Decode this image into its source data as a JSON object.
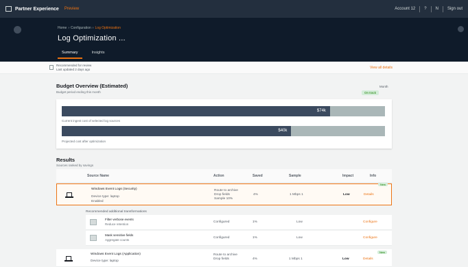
{
  "topnav": {
    "brand": "Partner Experience",
    "tag": "Preview",
    "right_text": "Account 12",
    "right_item_1": "?",
    "right_item_2": "N",
    "right_item_3": "Sign out"
  },
  "header": {
    "breadcrumbs": [
      "Home",
      "›",
      "Configuration",
      "›",
      "Log Optimization"
    ],
    "title": "Log Optimization ...",
    "tabs": [
      {
        "label": "Summary",
        "active": true
      },
      {
        "label": "Insights",
        "active": false
      }
    ]
  },
  "strip": {
    "line1": "Recommended for review",
    "line2": "Last updated 2 days ago",
    "link": "View all details"
  },
  "budget": {
    "title": "Budget Overview (Estimated)",
    "subtitle": "Budget period ending this month",
    "badge_top": "Month",
    "badge_status": "On track",
    "bar1": {
      "value_label": "$74k",
      "fill": 0.83,
      "caption": "Current ingest cost of selected log sources"
    },
    "bar2": {
      "value_label": "$40k",
      "fill": 0.71,
      "caption": "Projected cost after optimization"
    }
  },
  "results": {
    "title": "Results",
    "subtitle": "Sources ranked by savings",
    "columns": [
      "Source Name",
      "Action",
      "Saved",
      "Sample",
      "Impact",
      "Info"
    ],
    "rows": [
      {
        "name": "Windows Event Logs (Security)",
        "meta1": "Device type: laptop",
        "meta2": "Enabled",
        "action1": "Route to archive",
        "action2": "Drop fields",
        "action3": "Sample 10%",
        "saved": "4%",
        "sample": "1 Mbps 1",
        "impact": "Low",
        "info_link": "Details",
        "badge": "New"
      },
      {
        "name": "Windows Event Logs (Application)",
        "meta1": "Device type: laptop",
        "meta2": "",
        "action1": "Route to archive",
        "action2": "Drop fields",
        "action3": "Sample 10%",
        "saved": "4%",
        "sample": "1 Mbps 1",
        "impact": "Low",
        "info_link": "Details",
        "badge": "New"
      }
    ],
    "sub_label": "Recommended additional transformations",
    "subrows": [
      {
        "line1": "Filter verbose events",
        "line2": "Reduce retention",
        "action": "Configured",
        "saved": "1%",
        "sample": "Low",
        "link": "Configure"
      },
      {
        "line1": "Mask sensitive fields",
        "line2": "Aggregate counts",
        "action": "Configured",
        "saved": "1%",
        "sample": "Low",
        "link": "Configure"
      }
    ]
  }
}
